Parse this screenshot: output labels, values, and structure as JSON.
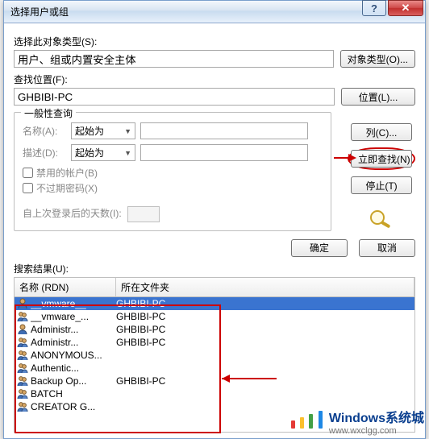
{
  "window": {
    "title": "选择用户或组",
    "help_icon": "?",
    "close_icon": "✕"
  },
  "fields": {
    "object_type_label": "选择此对象类型(S):",
    "object_type_value": "用户、组或内置安全主体",
    "object_type_button": "对象类型(O)...",
    "location_label": "查找位置(F):",
    "location_value": "GHBIBI-PC",
    "location_button": "位置(L)..."
  },
  "query": {
    "legend": "一般性查询",
    "name_label": "名称(A):",
    "name_match": "起始为",
    "desc_label": "描述(D):",
    "desc_match": "起始为",
    "cb_disabled": "禁用的帐户(B)",
    "cb_noexpire": "不过期密码(X)",
    "days_label": "自上次登录后的天数(I):"
  },
  "side": {
    "columns": "列(C)...",
    "find_now": "立即查找(N)",
    "stop": "停止(T)"
  },
  "actions": {
    "ok": "确定",
    "cancel": "取消"
  },
  "results": {
    "label": "搜索结果(U):",
    "col_name": "名称 (RDN)",
    "col_folder": "所在文件夹",
    "rows": [
      {
        "icon": "user",
        "name": "__vmware__",
        "folder": "GHBIBI-PC",
        "selected": true
      },
      {
        "icon": "group",
        "name": "__vmware_...",
        "folder": "GHBIBI-PC"
      },
      {
        "icon": "user",
        "name": "Administr...",
        "folder": "GHBIBI-PC"
      },
      {
        "icon": "group",
        "name": "Administr...",
        "folder": "GHBIBI-PC"
      },
      {
        "icon": "group",
        "name": "ANONYMOUS...",
        "folder": ""
      },
      {
        "icon": "group",
        "name": "Authentic...",
        "folder": ""
      },
      {
        "icon": "group",
        "name": "Backup Op...",
        "folder": "GHBIBI-PC"
      },
      {
        "icon": "group",
        "name": "BATCH",
        "folder": ""
      },
      {
        "icon": "group",
        "name": "CREATOR G...",
        "folder": ""
      }
    ]
  },
  "watermark": {
    "brand": "Windows系统城",
    "url": "www.wxclgg.com"
  }
}
